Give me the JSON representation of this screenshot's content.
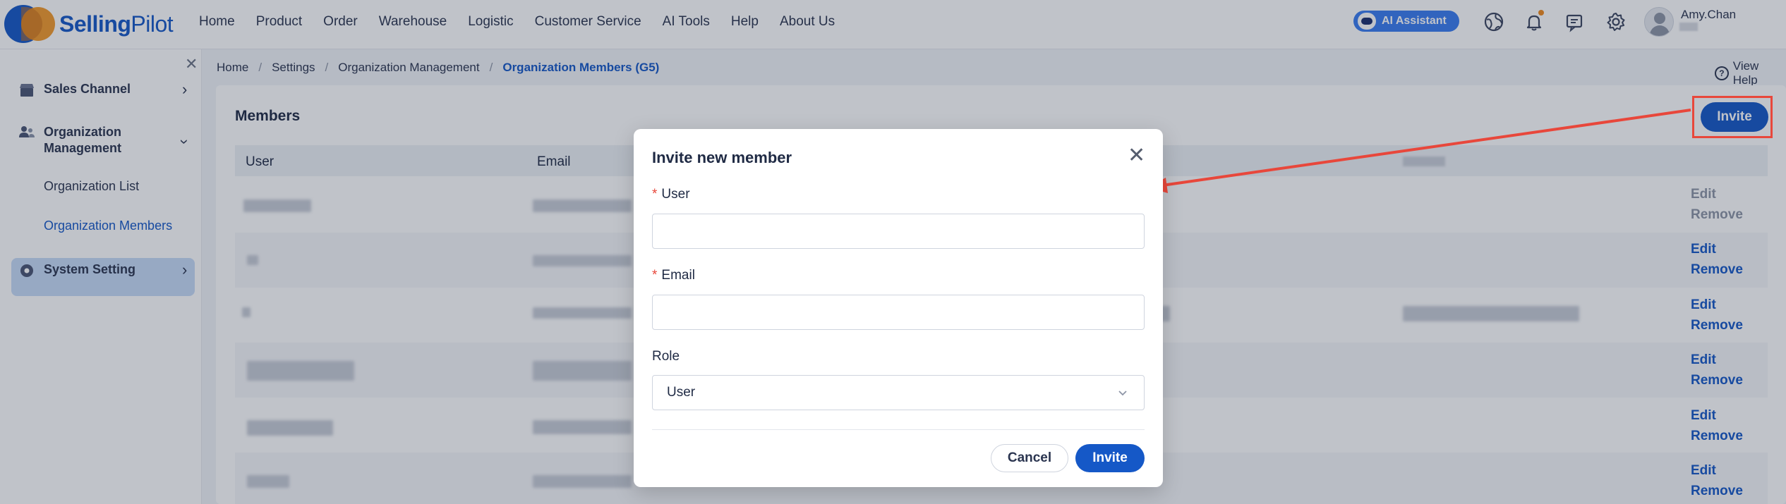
{
  "app": {
    "brand_bold": "Selling",
    "brand_rest": "Pilot"
  },
  "header": {
    "nav": [
      "Home",
      "Product",
      "Order",
      "Warehouse",
      "Logistic",
      "Customer Service",
      "AI Tools",
      "Help",
      "About Us"
    ],
    "ai_assistant_label": "AI Assistant",
    "user_name": "Amy.Chan",
    "icons": [
      "globe-icon",
      "bell-icon",
      "message-icon",
      "gear-icon",
      "avatar"
    ]
  },
  "sidebar": {
    "sales_channel": "Sales Channel",
    "org_management": "Organization Management",
    "org_list": "Organization List",
    "org_members": "Organization Members",
    "system_setting": "System Setting"
  },
  "breadcrumb": {
    "home": "Home",
    "settings": "Settings",
    "org_management": "Organization Management",
    "current": "Organization Members (G5)"
  },
  "page": {
    "view_help": "View Help",
    "title": "Members",
    "invite_label": "Invite",
    "columns": [
      "User",
      "Email"
    ],
    "row_actions": {
      "edit": "Edit",
      "remove": "Remove"
    }
  },
  "modal": {
    "title": "Invite new member",
    "required_mark": "*",
    "user_label": "User",
    "email_label": "Email",
    "role_label": "Role",
    "role_value": "User",
    "cancel_label": "Cancel",
    "invite_label": "Invite"
  },
  "colors": {
    "primary": "#1558c7",
    "highlight": "#e8473b",
    "accent_orange": "#f39a2b"
  }
}
